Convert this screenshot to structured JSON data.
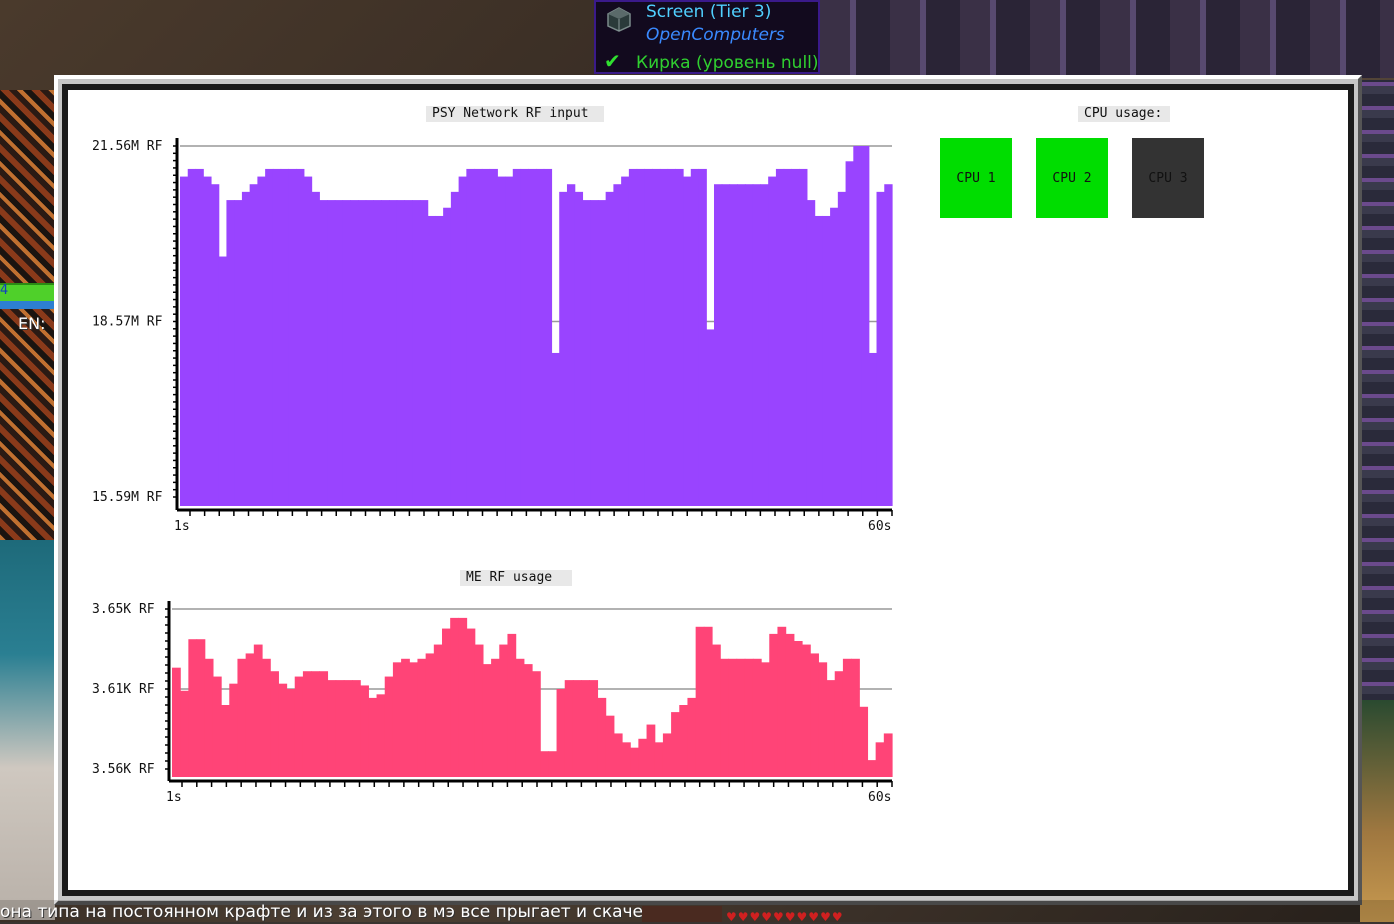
{
  "tooltip": {
    "title": "Screen (Tier 3)",
    "mod": "OpenComputers",
    "check_icon": "checkmark-icon",
    "tool": "Кирка (уровень null)",
    "colors": {
      "title": "#50d0ff",
      "mod": "#3a8aff",
      "tool": "#30d030"
    }
  },
  "hud": {
    "en_label": "EN:",
    "bar_value": "4"
  },
  "chat": {
    "message": "она типа на постоянном крафте и из за этого в мэ все прыгает и скачет",
    "hearts": "♥♥♥♥♥♥♥♥♥♥"
  },
  "cpu_panel": {
    "title": "CPU usage:",
    "cpus": [
      {
        "label": "CPU 1",
        "color": "#00dd00"
      },
      {
        "label": "CPU 2",
        "color": "#00dd00"
      },
      {
        "label": "CPU 3",
        "color": "#333333"
      }
    ]
  },
  "chart_data": [
    {
      "type": "bar",
      "title": "PSY Network RF input",
      "color": "#9944ff",
      "y_labels": [
        "21.56M RF",
        "18.57M RF",
        "15.59M RF"
      ],
      "x_labels": [
        "1s",
        "60s"
      ],
      "ylim": [
        15.59,
        21.56
      ],
      "unit": "M RF",
      "values": [
        21.04,
        21.17,
        21.17,
        21.04,
        20.91,
        19.68,
        20.64,
        20.64,
        20.78,
        20.91,
        21.04,
        21.17,
        21.17,
        21.17,
        21.17,
        21.17,
        21.04,
        20.78,
        20.64,
        20.64,
        20.64,
        20.64,
        20.64,
        20.64,
        20.64,
        20.64,
        20.64,
        20.64,
        20.64,
        20.64,
        20.64,
        20.64,
        20.37,
        20.37,
        20.51,
        20.78,
        21.04,
        21.17,
        21.17,
        21.17,
        21.17,
        21.04,
        21.04,
        21.17,
        21.17,
        21.17,
        21.17,
        21.17,
        18.04,
        20.78,
        20.91,
        20.78,
        20.64,
        20.64,
        20.64,
        20.78,
        20.91,
        21.04,
        21.17,
        21.17,
        21.17,
        21.17,
        21.17,
        21.17,
        21.17,
        21.04,
        21.17,
        21.17,
        18.44,
        20.91,
        20.91,
        20.91,
        20.91,
        20.91,
        20.91,
        20.91,
        21.04,
        21.17,
        21.17,
        21.17,
        21.17,
        20.64,
        20.37,
        20.37,
        20.51,
        20.78,
        21.3,
        21.56,
        21.56,
        18.04,
        20.78,
        20.91
      ]
    },
    {
      "type": "bar",
      "title": "ME RF usage",
      "color": "#ff4477",
      "y_labels": [
        "3.65K RF",
        "3.61K RF",
        "3.56K RF"
      ],
      "x_labels": [
        "1s",
        "60s"
      ],
      "ylim": [
        3.56,
        3.65
      ],
      "unit": "K RF",
      "values": [
        3.617,
        3.604,
        3.633,
        3.633,
        3.622,
        3.612,
        3.596,
        3.608,
        3.622,
        3.625,
        3.63,
        3.622,
        3.615,
        3.608,
        3.605,
        3.612,
        3.615,
        3.615,
        3.615,
        3.61,
        3.61,
        3.61,
        3.61,
        3.607,
        3.6,
        3.602,
        3.612,
        3.62,
        3.622,
        3.62,
        3.622,
        3.625,
        3.63,
        3.639,
        3.645,
        3.645,
        3.639,
        3.63,
        3.619,
        3.622,
        3.63,
        3.636,
        3.622,
        3.619,
        3.615,
        3.57,
        3.57,
        3.605,
        3.61,
        3.61,
        3.61,
        3.61,
        3.6,
        3.59,
        3.58,
        3.575,
        3.572,
        3.577,
        3.585,
        3.575,
        3.58,
        3.592,
        3.596,
        3.6,
        3.64,
        3.64,
        3.63,
        3.622,
        3.622,
        3.622,
        3.622,
        3.622,
        3.62,
        3.636,
        3.64,
        3.636,
        3.632,
        3.63,
        3.625,
        3.62,
        3.61,
        3.615,
        3.622,
        3.622,
        3.595,
        3.565,
        3.575,
        3.58
      ]
    }
  ]
}
